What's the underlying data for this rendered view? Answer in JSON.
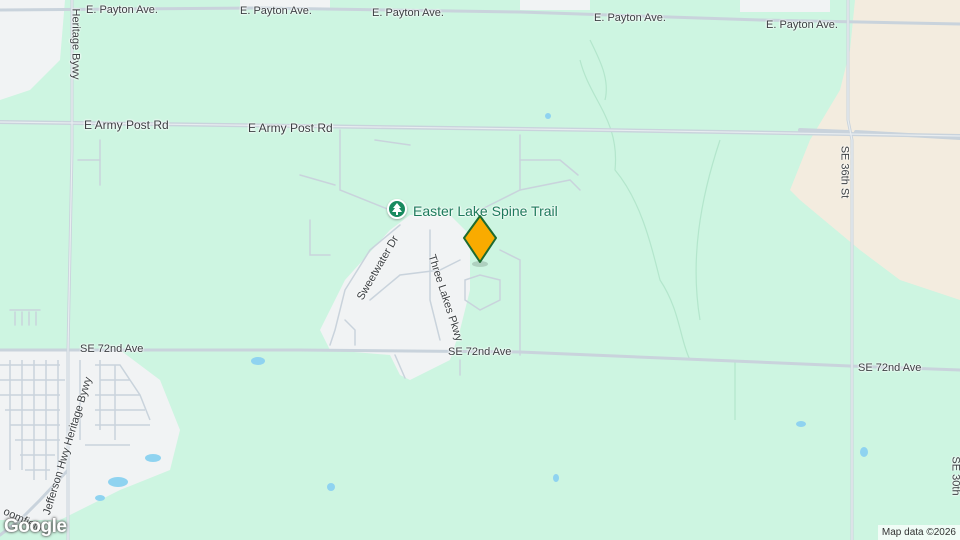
{
  "map": {
    "colors": {
      "park": "#cdf5e1",
      "urban": "#f1f3f4",
      "sand": "#f3ecdf",
      "road": "#c9d3dc",
      "water": "#8fd3f0",
      "marker": "#f9ab00",
      "marker_outline": "#1e6b2f",
      "poi": "#188a5e"
    },
    "roads": {
      "payton_1": "E. Payton Ave.",
      "payton_2": "E. Payton Ave.",
      "payton_3": "E. Payton Ave.",
      "payton_4": "E. Payton Ave.",
      "payton_5": "E. Payton Ave.",
      "army_1": "E Army Post Rd",
      "army_2": "E Army Post Rd",
      "se72_1": "SE 72nd Ave",
      "se72_2": "SE 72nd Ave",
      "se72_3": "SE 72nd Ave",
      "se36": "SE 36th St",
      "heritage": "Heritage Bywy",
      "jefferson": "Jefferson Hwy Heritage Bywy",
      "sweetwater": "Sweetwater Dr",
      "three_lakes": "Three Lakes Pkwy",
      "bloomfield": "oomfield",
      "se30": "SE 30th"
    },
    "poi": {
      "name": "Easter Lake Spine Trail",
      "icon": "tree-icon"
    },
    "marker_icon": "location-pin-icon",
    "attribution": "Map data ©2026",
    "logo": "Google"
  }
}
